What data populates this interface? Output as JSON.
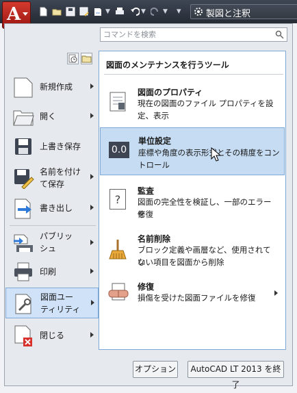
{
  "titlebar": {
    "title": "製図と注釈"
  },
  "search": {
    "placeholder": "コマンドを検索"
  },
  "left_menu": {
    "items": [
      {
        "label": "新規作成",
        "icon": "new-document-icon",
        "has_submenu": true
      },
      {
        "label": "開く",
        "icon": "open-folder-icon",
        "has_submenu": true
      },
      {
        "label": "上書き保存",
        "icon": "save-icon",
        "has_submenu": false
      },
      {
        "label_line1": "名前を付け",
        "label_line2": "て保存",
        "icon": "save-as-icon",
        "has_submenu": true
      },
      {
        "label": "書き出し",
        "icon": "export-icon",
        "has_submenu": true
      },
      {
        "label_line1": "パブリッ",
        "label_line2": "シュ",
        "icon": "publish-icon",
        "has_submenu": true
      },
      {
        "label": "印刷",
        "icon": "print-icon",
        "has_submenu": true
      },
      {
        "label_line1": "図面ユー",
        "label_line2": "ティリティ",
        "icon": "drawing-utilities-icon",
        "has_submenu": true,
        "selected": true
      },
      {
        "label": "閉じる",
        "icon": "close-document-icon",
        "has_submenu": true
      }
    ]
  },
  "panel": {
    "title": "図面のメンテナンスを行うツール",
    "entries": [
      {
        "title": "図面のプロパティ",
        "desc_line1": "現在の図面のファイル プロパティを設",
        "desc_line2": "定、表示",
        "icon": "drawing-properties-icon"
      },
      {
        "title": "単位設定",
        "desc_line1": "座標や角度の表示形式とその精度をコン",
        "desc_line2": "トロール",
        "icon": "units-icon",
        "icon_text": "0.0",
        "highlighted": true
      },
      {
        "title": "監査",
        "desc_line1": "図面の完全性を検証し、一部のエラーを",
        "desc_line2": "修復",
        "icon": "audit-icon",
        "icon_text": "?"
      },
      {
        "title": "名前削除",
        "desc_line1": "ブロック定義や画層など、使用されてい",
        "desc_line2": "ない項目を図面から削除",
        "icon": "purge-icon"
      },
      {
        "title": "修復",
        "desc_line1": "損傷を受けた図面ファイルを修復",
        "icon": "recover-icon",
        "has_submenu": true
      }
    ]
  },
  "footer": {
    "options_label": "オプション",
    "exit_label": "AutoCAD LT 2013 を終了"
  },
  "colors": {
    "app_button": "#c0261c",
    "highlight": "#c5dcf3",
    "highlight_border": "#7ca7d6",
    "titlebar": "#2f3541"
  }
}
